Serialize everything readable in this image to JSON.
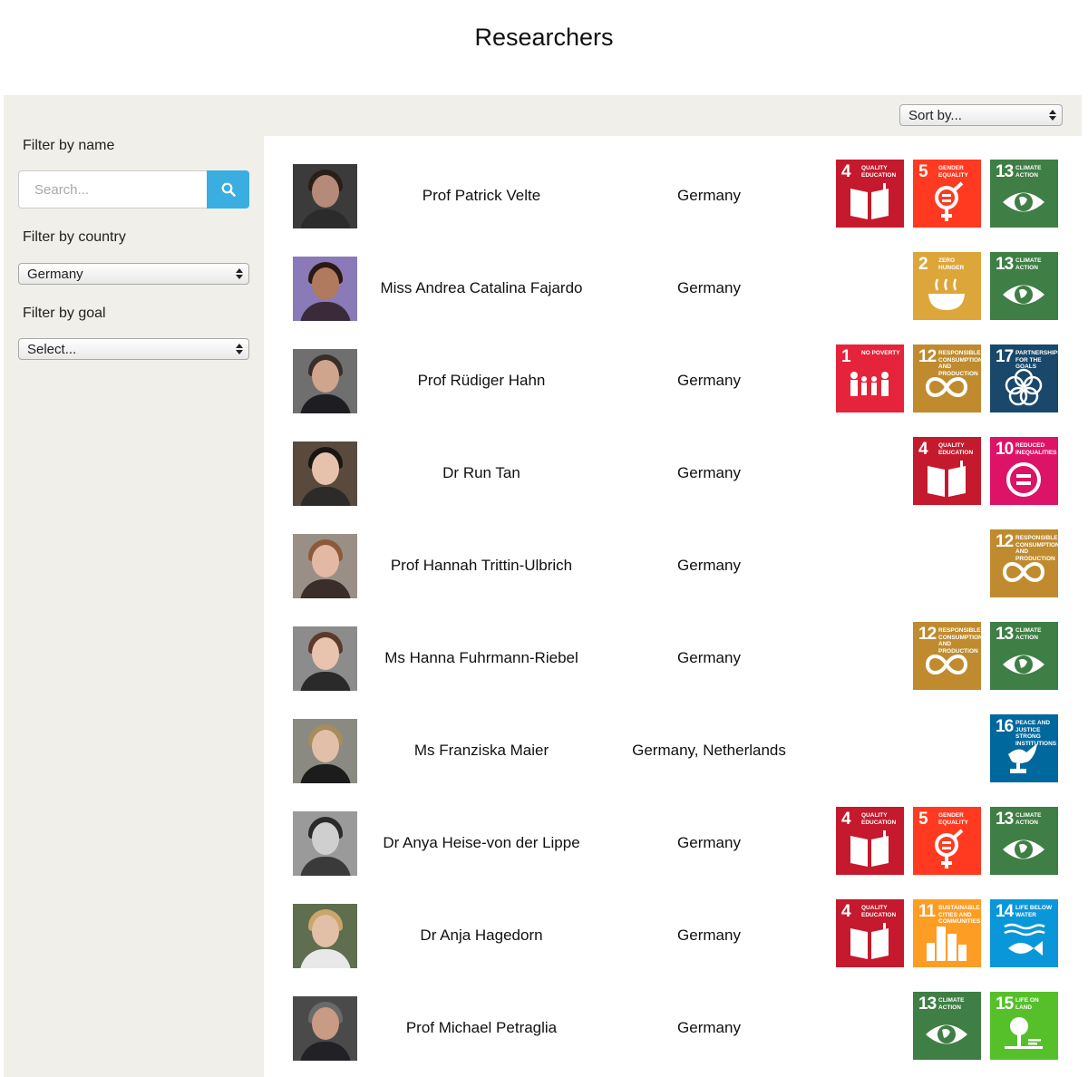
{
  "page": {
    "title": "Researchers"
  },
  "toolbar": {
    "sort_value": "Sort by..."
  },
  "filters": {
    "name_label": "Filter by name",
    "search_placeholder": "Search...",
    "country_label": "Filter by country",
    "country_value": "Germany",
    "goal_label": "Filter by goal",
    "goal_value": "Select..."
  },
  "goals": {
    "1": {
      "num": "1",
      "label": "No poverty",
      "color": "#e5243b",
      "icon": "people-icon"
    },
    "2": {
      "num": "2",
      "label": "Zero hunger",
      "color": "#dda63a",
      "icon": "bowl-icon"
    },
    "4": {
      "num": "4",
      "label": "Quality education",
      "color": "#c5192d",
      "icon": "book-icon"
    },
    "5": {
      "num": "5",
      "label": "Gender equality",
      "color": "#ff3a21",
      "icon": "gender-icon"
    },
    "10": {
      "num": "10",
      "label": "Reduced inequalities",
      "color": "#dd1367",
      "icon": "equal-icon"
    },
    "11": {
      "num": "11",
      "label": "Sustainable cities and communities",
      "color": "#fd9d24",
      "icon": "city-icon"
    },
    "12": {
      "num": "12",
      "label": "Responsible consumption and production",
      "color": "#bf8b2e",
      "icon": "infinity-icon"
    },
    "13": {
      "num": "13",
      "label": "Climate action",
      "color": "#3f7e44",
      "icon": "eye-globe-icon"
    },
    "14": {
      "num": "14",
      "label": "Life below water",
      "color": "#0a97d9",
      "icon": "fish-icon"
    },
    "15": {
      "num": "15",
      "label": "Life on land",
      "color": "#56c02b",
      "icon": "tree-icon"
    },
    "16": {
      "num": "16",
      "label": "Peace and justice strong institutions",
      "color": "#00689d",
      "icon": "dove-icon"
    },
    "17": {
      "num": "17",
      "label": "Partnerships for the goals",
      "color": "#19486a",
      "icon": "rings-icon"
    }
  },
  "researchers": [
    {
      "name": "Prof Patrick Velte",
      "country": "Germany",
      "goals": [
        "4",
        "5",
        "13"
      ]
    },
    {
      "name": "Miss Andrea Catalina Fajardo",
      "country": "Germany",
      "goals": [
        "2",
        "13"
      ]
    },
    {
      "name": "Prof Rüdiger Hahn",
      "country": "Germany",
      "goals": [
        "1",
        "12",
        "17"
      ]
    },
    {
      "name": "Dr Run Tan",
      "country": "Germany",
      "goals": [
        "4",
        "10"
      ]
    },
    {
      "name": "Prof Hannah Trittin-Ulbrich",
      "country": "Germany",
      "goals": [
        "12"
      ]
    },
    {
      "name": "Ms Hanna Fuhrmann-Riebel",
      "country": "Germany",
      "goals": [
        "12",
        "13"
      ]
    },
    {
      "name": "Ms Franziska Maier",
      "country": "Germany, Netherlands",
      "goals": [
        "16"
      ]
    },
    {
      "name": "Dr Anya Heise-von der Lippe",
      "country": "Germany",
      "goals": [
        "4",
        "5",
        "13"
      ]
    },
    {
      "name": "Dr Anja Hagedorn",
      "country": "Germany",
      "goals": [
        "4",
        "11",
        "14"
      ]
    },
    {
      "name": "Prof Michael Petraglia",
      "country": "Germany",
      "goals": [
        "13",
        "15"
      ]
    }
  ]
}
